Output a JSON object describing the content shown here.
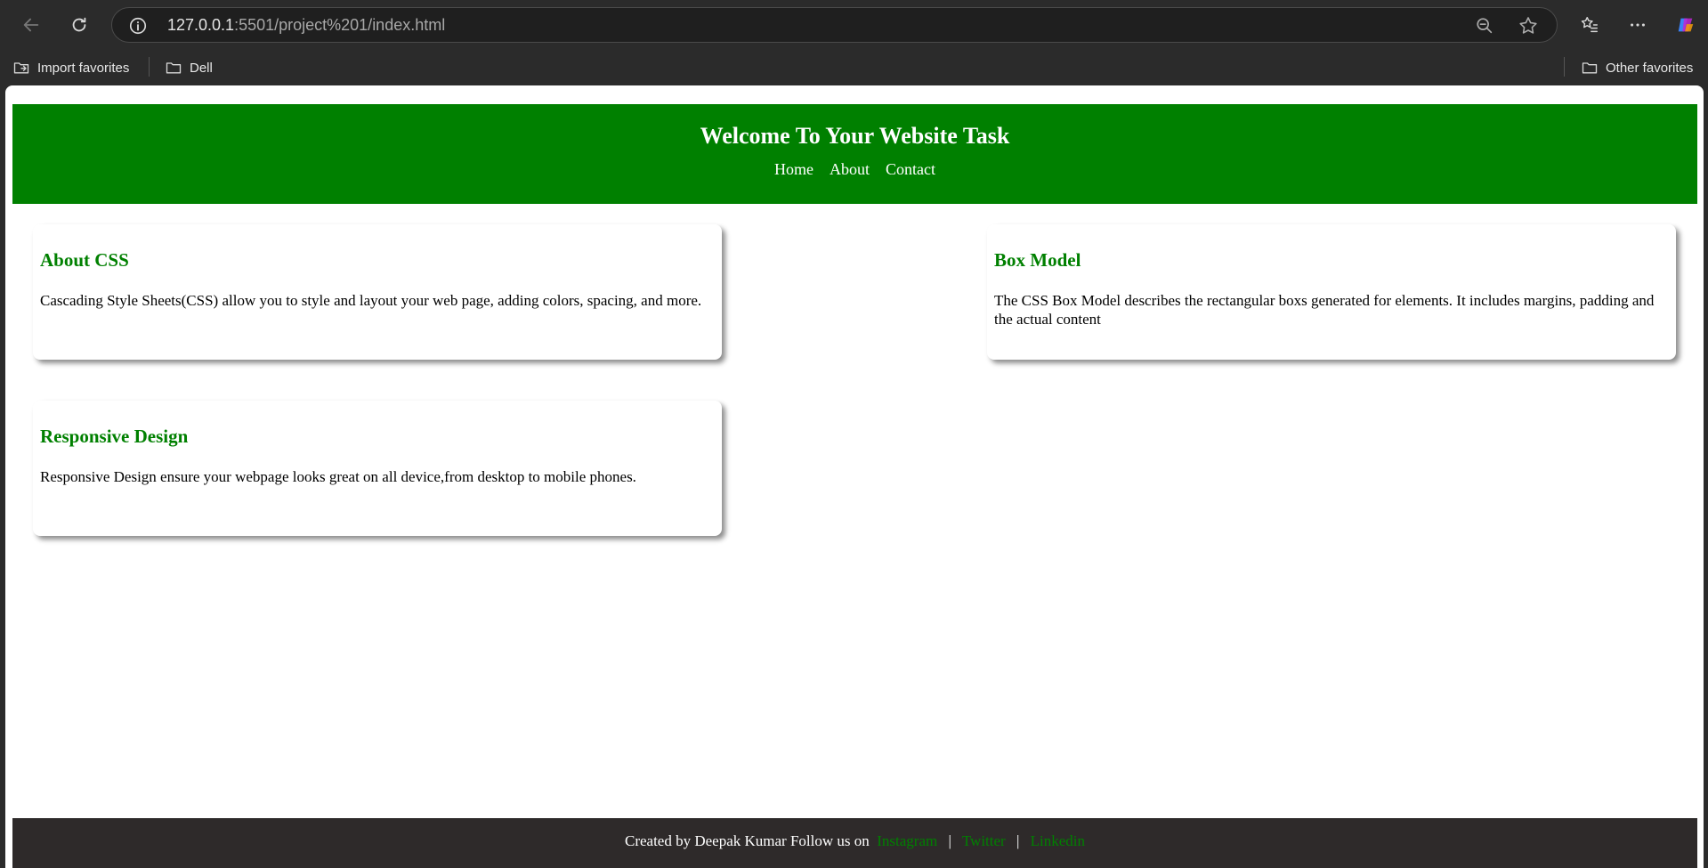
{
  "browser": {
    "url_host": "127.0.0.1",
    "url_path": ":5501/project%201/index.html",
    "bookmarks": [
      "Import favorites",
      "Dell"
    ],
    "other_favorites": "Other favorites"
  },
  "page": {
    "title": "Welcome To Your Website Task",
    "nav": [
      "Home",
      "About",
      "Contact"
    ],
    "cards": [
      {
        "title": "About CSS",
        "body": "Cascading Style Sheets(CSS) allow you to style and layout your web page, adding colors, spacing, and more."
      },
      {
        "title": "Box Model",
        "body": "The CSS Box Model describes the rectangular boxs generated for elements. It includes margins, padding and the actual content"
      },
      {
        "title": "Responsive Design",
        "body": "Responsive Design ensure your webpage looks great on all device,from desktop to mobile phones."
      }
    ],
    "footer": {
      "text": "Created by Deepak Kumar Follow us on",
      "links": [
        "Instagram",
        "Twitter",
        "Linkedin"
      ],
      "separator": "|"
    }
  },
  "colors": {
    "accent": "#008000",
    "footer_bg": "#2e2a2a",
    "chrome_bg": "#2b2b2b"
  }
}
